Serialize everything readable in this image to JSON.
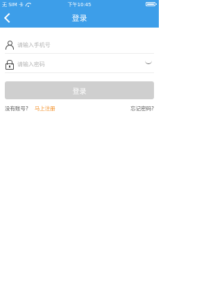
{
  "status_bar": {
    "carrier": "无 SIM 卡",
    "time": "下午10:45"
  },
  "nav": {
    "title": "登录"
  },
  "form": {
    "phone_placeholder": "请输入手机号",
    "password_placeholder": "请输入密码",
    "login_label": "登录"
  },
  "links": {
    "no_account": "没有账号?",
    "register": "马上注册",
    "forgot": "忘记密码?"
  },
  "colors": {
    "header_bg": "#3d9ee9",
    "button_disabled": "#cfcfcf",
    "link_accent": "#f28a1c"
  }
}
